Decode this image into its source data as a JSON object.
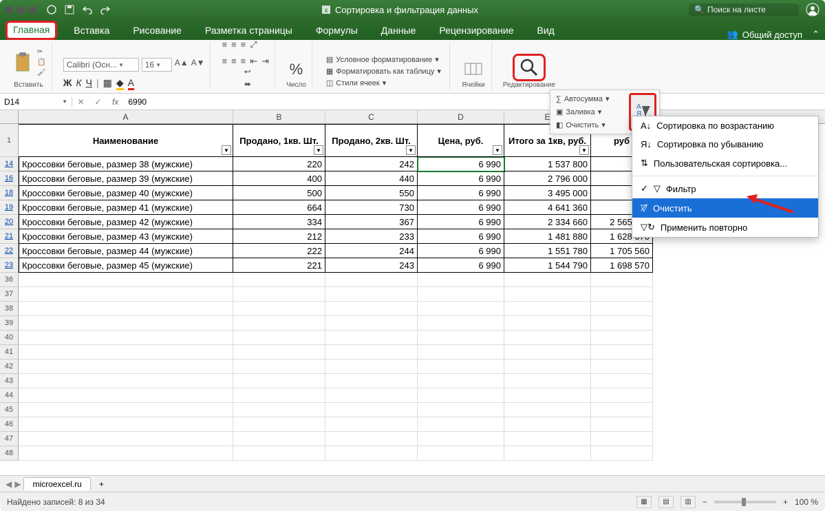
{
  "titlebar": {
    "doc_title": "Сортировка и фильтрация данных",
    "search_placeholder": "Поиск на листе"
  },
  "tabs": {
    "home": "Главная",
    "insert": "Вставка",
    "draw": "Рисование",
    "layout": "Разметка страницы",
    "formulas": "Формулы",
    "data": "Данные",
    "review": "Рецензирование",
    "view": "Вид",
    "share": "Общий доступ"
  },
  "ribbon": {
    "paste": "Вставить",
    "font_name": "Calibri (Осн...",
    "font_size": "16",
    "number": "Число",
    "cond_fmt": "Условное форматирование",
    "fmt_table": "Форматировать как таблицу",
    "cell_styles": "Стили ячеек",
    "cells": "Ячейки",
    "editing": "Редактирование"
  },
  "edit_pane": {
    "autosum": "Автосумма",
    "fill": "Заливка",
    "clear": "Очистить"
  },
  "dropdown": {
    "sort_asc": "Сортировка по возрастанию",
    "sort_desc": "Сортировка по убыванию",
    "custom_sort": "Пользовательская сортировка...",
    "filter": "Фильтр",
    "clear": "Очистить",
    "reapply": "Применить повторно"
  },
  "namebox": {
    "ref": "D14",
    "value": "6990"
  },
  "columns": [
    "A",
    "B",
    "C",
    "D",
    "E",
    "F"
  ],
  "headers": {
    "name": "Наименование",
    "q1": "Продано, 1кв. Шт.",
    "q2": "Продано, 2кв. Шт.",
    "price": "Цена, руб.",
    "total1": "Итого за 1кв, руб.",
    "total2": "руб"
  },
  "header_row": "1",
  "rows": [
    {
      "n": "14",
      "a": "Кроссовки беговые, размер 38 (мужские)",
      "b": "220",
      "c": "242",
      "d": "6 990",
      "e": "1 537 800",
      "f": "1 6"
    },
    {
      "n": "16",
      "a": "Кроссовки беговые, размер 39 (мужские)",
      "b": "400",
      "c": "440",
      "d": "6 990",
      "e": "2 796 000",
      "f": "3 0"
    },
    {
      "n": "18",
      "a": "Кроссовки беговые, размер 40 (мужские)",
      "b": "500",
      "c": "550",
      "d": "6 990",
      "e": "3 495 000",
      "f": "3 8"
    },
    {
      "n": "19",
      "a": "Кроссовки беговые, размер 41 (мужские)",
      "b": "664",
      "c": "730",
      "d": "6 990",
      "e": "4 641 360",
      "f": "5 1"
    },
    {
      "n": "20",
      "a": "Кроссовки беговые, размер 42 (мужские)",
      "b": "334",
      "c": "367",
      "d": "6 990",
      "e": "2 334 660",
      "f": "2 565 330"
    },
    {
      "n": "21",
      "a": "Кроссовки беговые, размер 43 (мужские)",
      "b": "212",
      "c": "233",
      "d": "6 990",
      "e": "1 481 880",
      "f": "1 628 670"
    },
    {
      "n": "22",
      "a": "Кроссовки беговые, размер 44 (мужские)",
      "b": "222",
      "c": "244",
      "d": "6 990",
      "e": "1 551 780",
      "f": "1 705 560"
    },
    {
      "n": "23",
      "a": "Кроссовки беговые, размер 45 (мужские)",
      "b": "221",
      "c": "243",
      "d": "6 990",
      "e": "1 544 790",
      "f": "1 698 570"
    }
  ],
  "empty_rows": [
    "36",
    "37",
    "38",
    "39",
    "40",
    "41",
    "42",
    "43",
    "44",
    "45",
    "46",
    "47",
    "48"
  ],
  "sheet_tab": "microexcel.ru",
  "status": {
    "found": "Найдено записей: 8 из 34",
    "zoom": "100 %"
  }
}
